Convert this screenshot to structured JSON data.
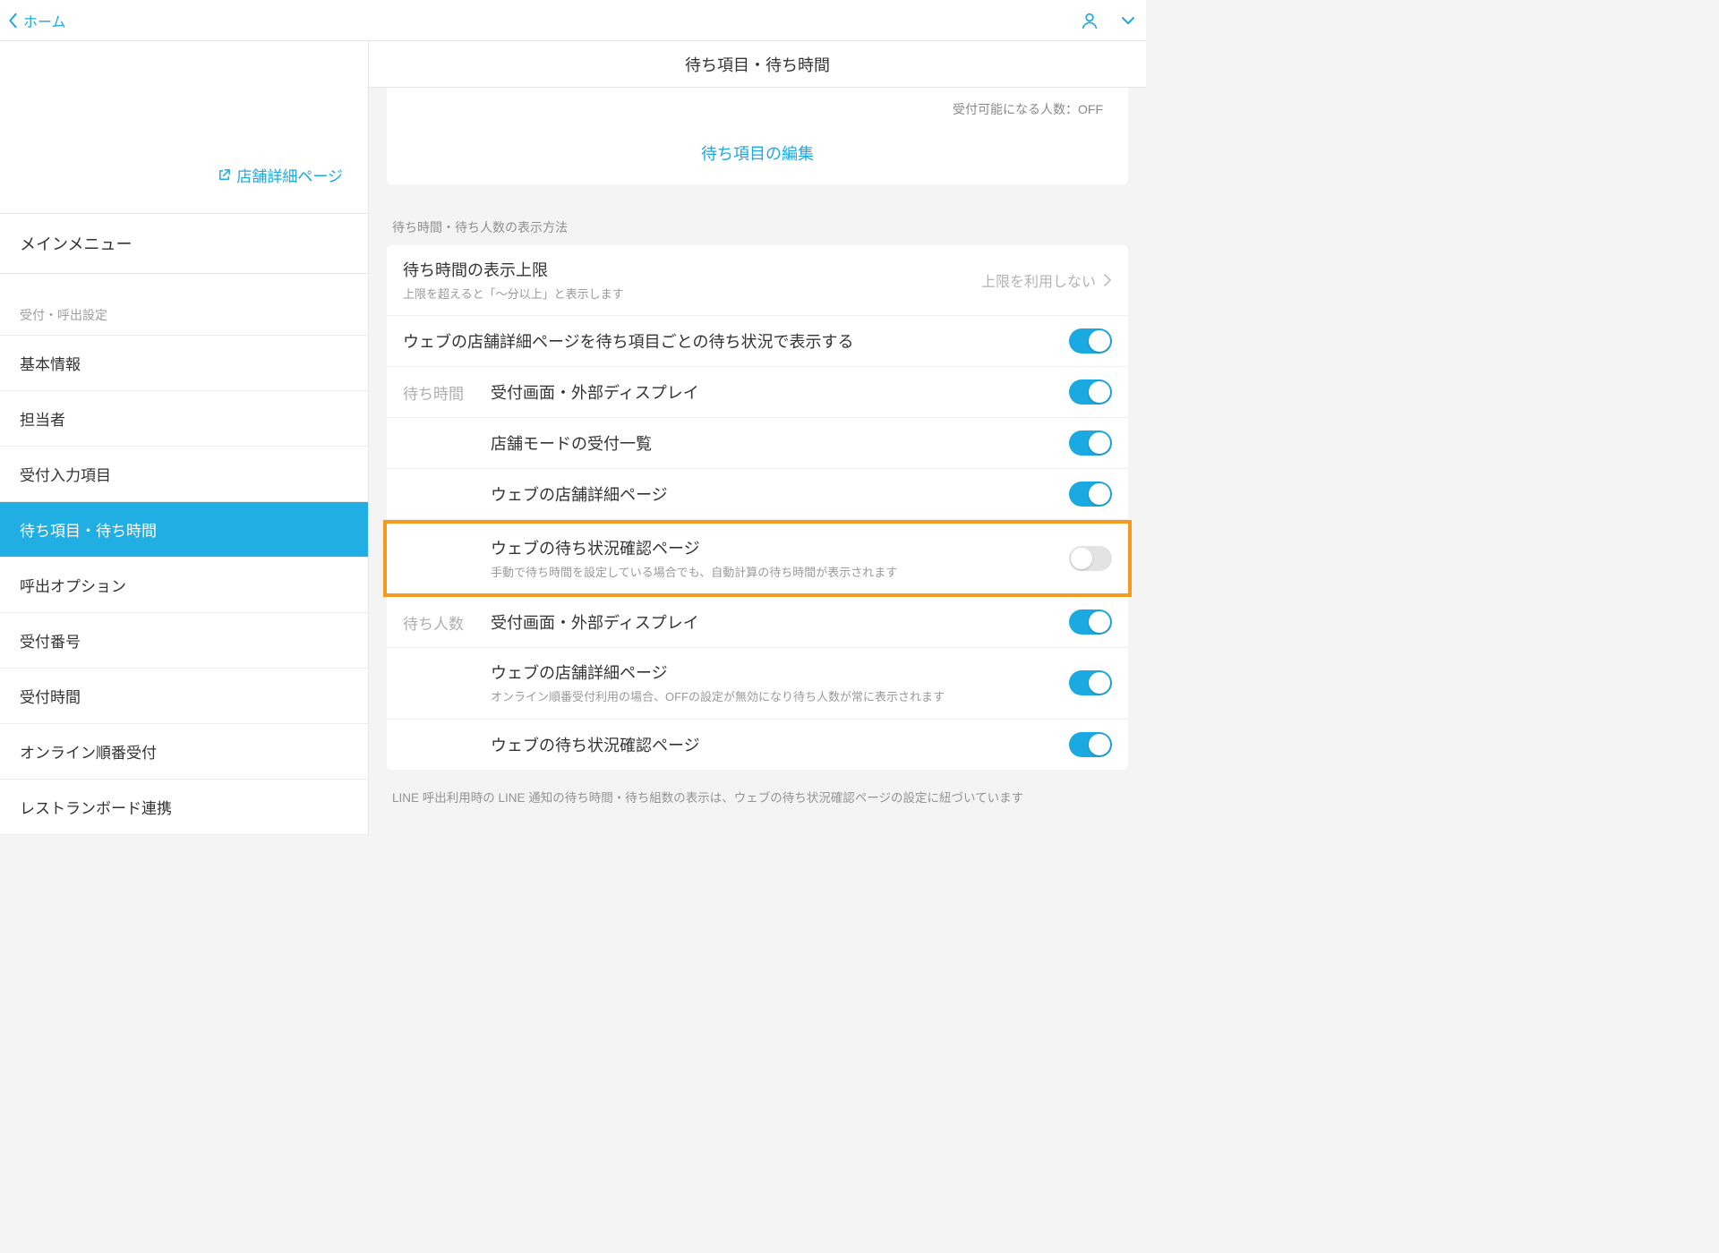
{
  "topbar": {
    "back_label": "ホーム"
  },
  "sidebar": {
    "store_detail_link": "店舗詳細ページ",
    "main_menu_label": "メインメニュー",
    "section_caption": "受付・呼出設定",
    "items": [
      {
        "label": "基本情報"
      },
      {
        "label": "担当者"
      },
      {
        "label": "受付入力項目"
      },
      {
        "label": "待ち項目・待ち時間"
      },
      {
        "label": "呼出オプション"
      },
      {
        "label": "受付番号"
      },
      {
        "label": "受付時間"
      },
      {
        "label": "オンライン順番受付"
      },
      {
        "label": "レストランボード連携"
      }
    ],
    "active_index": 3
  },
  "main": {
    "header_title": "待ち項目・待ち時間",
    "headcount_text": "受付可能になる人数：OFF",
    "edit_items_label": "待ち項目の編集",
    "group_label": "待ち時間・待ち人数の表示方法",
    "rows": [
      {
        "title": "待ち時間の表示上限",
        "sub": "上限を超えると「〜分以上」と表示します",
        "tail_text": "上限を利用しない",
        "chevron": true
      },
      {
        "title": "ウェブの店舗詳細ページを待ち項目ごとの待ち状況で表示する",
        "toggle": true,
        "on": true
      },
      {
        "prefix": "待ち時間",
        "title": "受付画面・外部ディスプレイ",
        "toggle": true,
        "on": true
      },
      {
        "title": "店舗モードの受付一覧",
        "indent": true,
        "toggle": true,
        "on": true
      },
      {
        "title": "ウェブの店舗詳細ページ",
        "indent": true,
        "toggle": true,
        "on": true
      },
      {
        "title": "ウェブの待ち状況確認ページ",
        "sub": "手動で待ち時間を設定している場合でも、自動計算の待ち時間が表示されます",
        "indent": true,
        "toggle": true,
        "on": false,
        "highlight": true
      },
      {
        "prefix": "待ち人数",
        "title": "受付画面・外部ディスプレイ",
        "toggle": true,
        "on": true
      },
      {
        "title": "ウェブの店舗詳細ページ",
        "sub": "オンライン順番受付利用の場合、OFFの設定が無効になり待ち人数が常に表示されます",
        "indent": true,
        "toggle": true,
        "on": true
      },
      {
        "title": "ウェブの待ち状況確認ページ",
        "indent": true,
        "toggle": true,
        "on": true
      }
    ],
    "bottom_note": "LINE 呼出利用時の LINE 通知の待ち時間・待ち組数の表示は、ウェブの待ち状況確認ページの設定に紐づいています"
  }
}
